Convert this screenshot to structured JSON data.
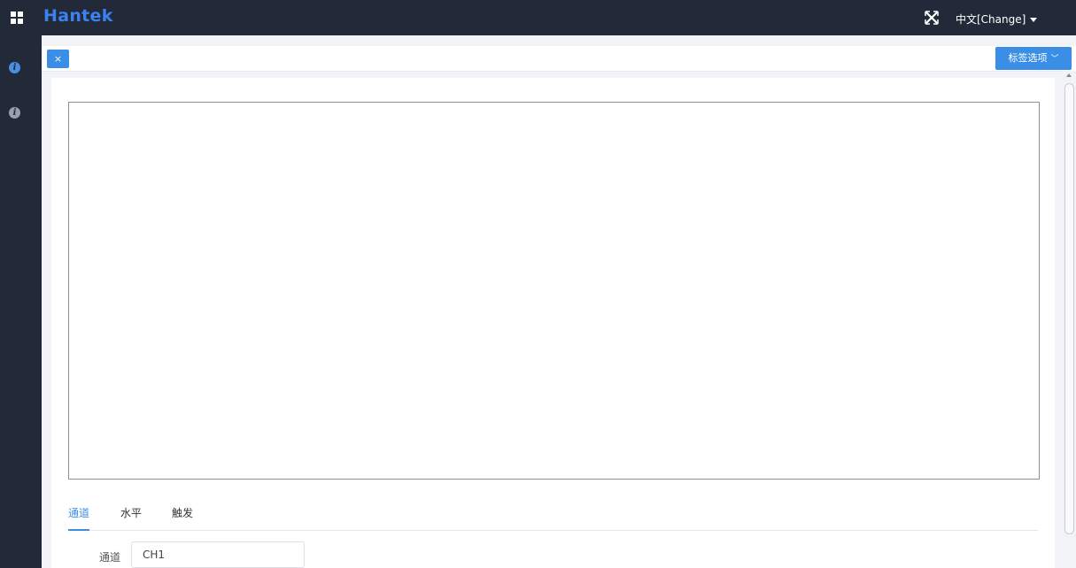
{
  "header": {
    "logo": "Hantek",
    "language_label": "中文[Change]",
    "icons": {
      "apps": "grid-icon",
      "fullscreen": "fullscreen-icon",
      "language_caret": "caret-down-icon"
    }
  },
  "sidebar": {
    "items": [
      {
        "icon": "info-icon",
        "state": "active"
      },
      {
        "icon": "info-icon",
        "state": "inactive"
      }
    ]
  },
  "tabbar": {
    "close_label": "×",
    "options_label": "标签选项"
  },
  "bottom_tabs": [
    {
      "label": "通道",
      "active": true
    },
    {
      "label": "水平",
      "active": false
    },
    {
      "label": "触发",
      "active": false
    }
  ],
  "channel_form": {
    "label": "通道",
    "value": "CH1"
  },
  "colors": {
    "topbar_bg": "#222a3a",
    "accent": "#3a8ee6",
    "logo": "#3b82f0"
  }
}
